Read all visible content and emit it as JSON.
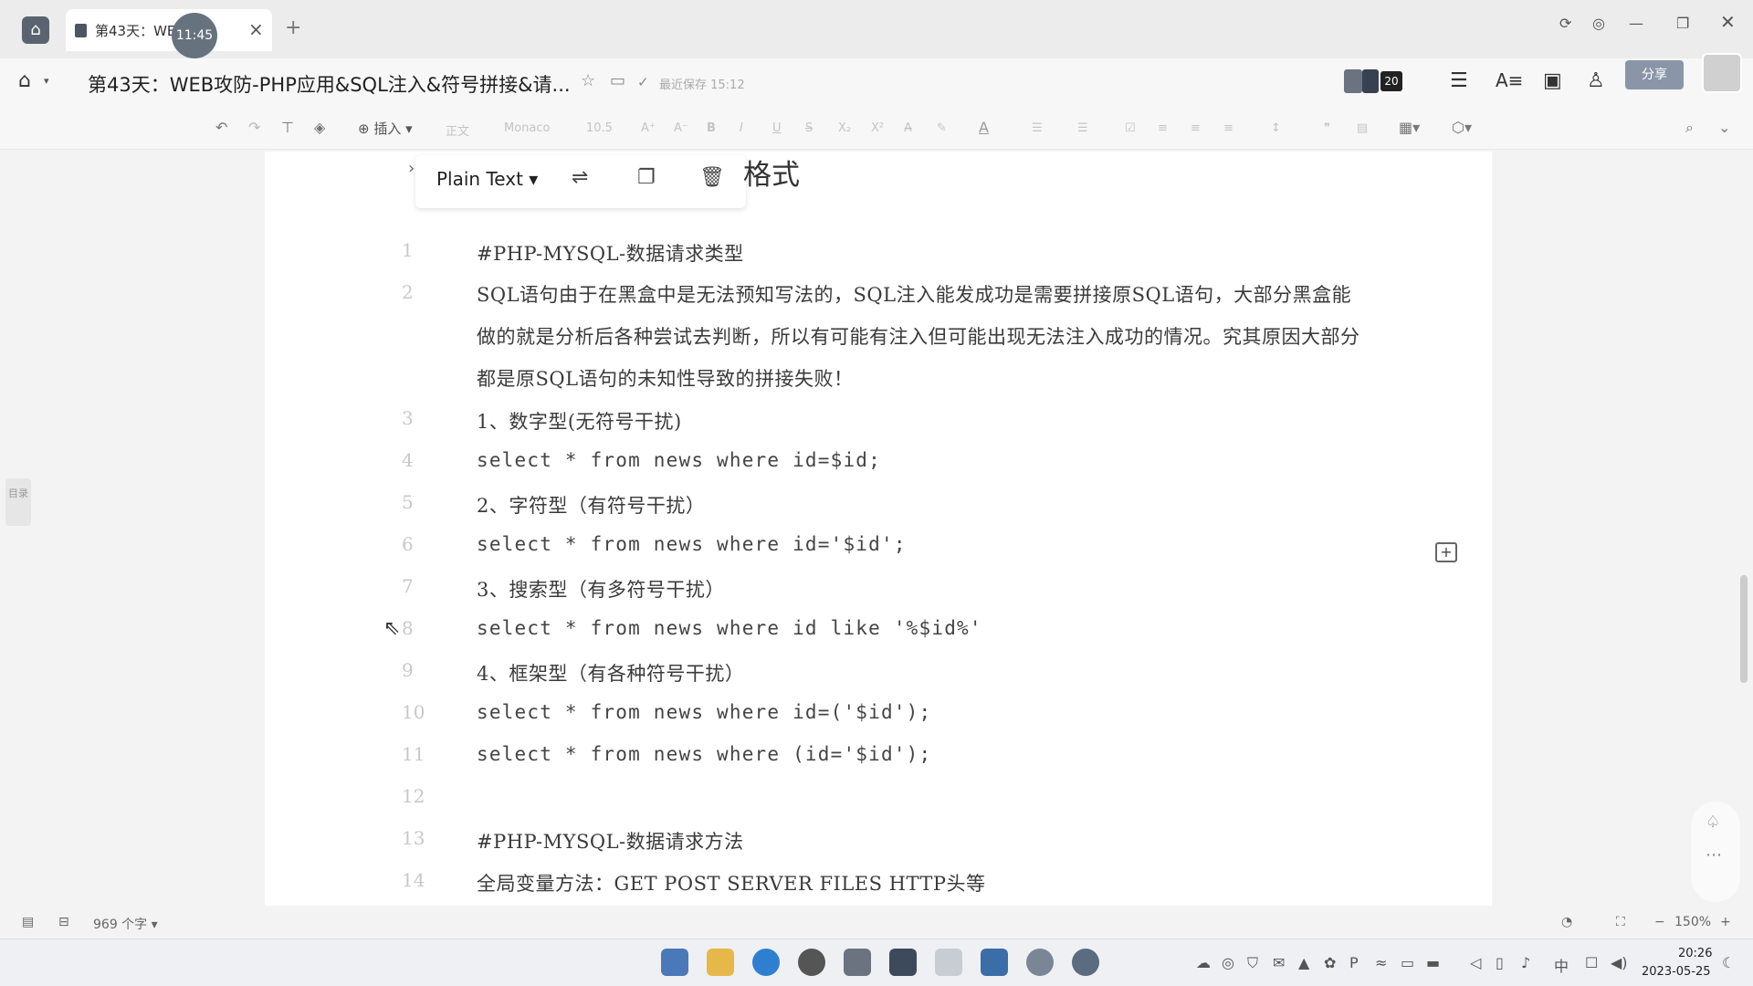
{
  "tab": {
    "title": "第43天：WEB攻防-PHP应用&SQL注入&符号拼接&请求方法",
    "title_visible": "第43天：WEB",
    "title_tail": "P...",
    "close": "×",
    "add": "+"
  },
  "timer_badge": "11:45",
  "document": {
    "title": "第43天：WEB攻防-PHP应用&SQL注入&符号拼接&请...",
    "save_status": "最近保存 15:12",
    "collaborator_count": "20",
    "share_label": "分享"
  },
  "toolbar": {
    "insert_label": "插入",
    "style_label": "正文",
    "font_name": "Monaco",
    "font_size": "10.5"
  },
  "code_block": {
    "language": "Plain Text",
    "partial_heading": "格式",
    "lines": [
      {
        "n": "1",
        "text": "#PHP-MYSQL-数据请求类型"
      },
      {
        "n": "2",
        "text": "SQL语句由于在黑盒中是无法预知写法的，SQL注入能发成功是需要拼接原SQL语句，大部分黑盒能做的就是分析后各种尝试去判断，所以有可能有注入但可能出现无法注入成功的情况。究其原因大部分都是原SQL语句的未知性导致的拼接失败！"
      },
      {
        "n": "3",
        "text": "1、数字型(无符号干扰)"
      },
      {
        "n": "4",
        "text": "select * from news where id=$id;"
      },
      {
        "n": "5",
        "text": "2、字符型（有符号干扰）"
      },
      {
        "n": "6",
        "text": "select * from news where id='$id';"
      },
      {
        "n": "7",
        "text": "3、搜索型（有多符号干扰）"
      },
      {
        "n": "8",
        "text": "select * from news where id like '%$id%'"
      },
      {
        "n": "9",
        "text": "4、框架型（有各种符号干扰）"
      },
      {
        "n": "10",
        "text": "select * from news where id=('$id');"
      },
      {
        "n": "11",
        "text": "select * from news where (id='$id');"
      },
      {
        "n": "12",
        "text": ""
      },
      {
        "n": "13",
        "text": "#PHP-MYSQL-数据请求方法"
      },
      {
        "n": "14",
        "text": "全局变量方法：GET POST SERVER FILES HTTP头等"
      }
    ]
  },
  "sidebar": {
    "toc_label": "目录"
  },
  "statusbar": {
    "word_count": "969 个字",
    "zoom": "150%",
    "zoom_minus": "−",
    "zoom_plus": "+"
  },
  "taskbar": {
    "time": "20:26",
    "date": "2023-05-25",
    "ime": "中"
  },
  "icons": [
    "home-icon",
    "star-icon",
    "folder-icon",
    "cloud-check-icon",
    "menu-icon",
    "text-size-icon",
    "present-icon",
    "user-add-icon",
    "undo-icon",
    "redo-icon",
    "format-painter-icon",
    "eraser-icon",
    "wrap-icon",
    "copy-icon",
    "trash-icon",
    "comment-add-icon",
    "search-icon",
    "collapse-icon"
  ],
  "colors": {
    "share_button": "#8a96a8",
    "page_bg": "#ffffff",
    "chrome_bg": "#f3f3f3"
  }
}
